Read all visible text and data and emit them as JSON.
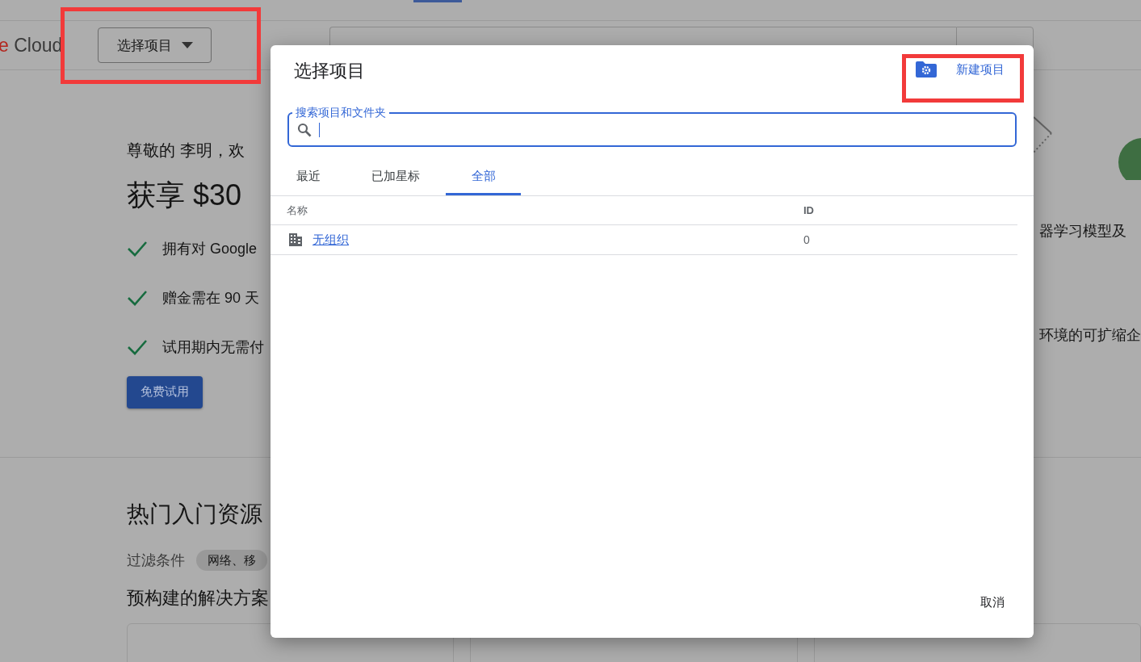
{
  "header": {
    "logo": {
      "accent": "e",
      "text": "Cloud"
    },
    "project_button": "选择项目"
  },
  "hero": {
    "greeting": "尊敬的 李明，欢",
    "title": "获享 $30",
    "benefits": [
      "拥有对 Google",
      "赠金需在 90 天",
      "试用期内无需付"
    ],
    "cta": "免费试用",
    "side_texts": [
      "器学习模型及",
      "环境的可扩缩企"
    ]
  },
  "resources": {
    "title": "热门入门资源",
    "filter_label": "过滤条件",
    "filter_chip": "网络、移",
    "subtitle": "预构建的解决方案"
  },
  "dialog": {
    "title": "选择项目",
    "new_project": "新建项目",
    "search": {
      "label": "搜索项目和文件夹"
    },
    "tabs": [
      {
        "label": "最近",
        "selected": false
      },
      {
        "label": "已加星标",
        "selected": false
      },
      {
        "label": "全部",
        "selected": true
      }
    ],
    "columns": [
      "名称",
      "ID"
    ],
    "rows": [
      {
        "name": "无组织",
        "id": "0"
      }
    ],
    "cancel": "取消"
  }
}
